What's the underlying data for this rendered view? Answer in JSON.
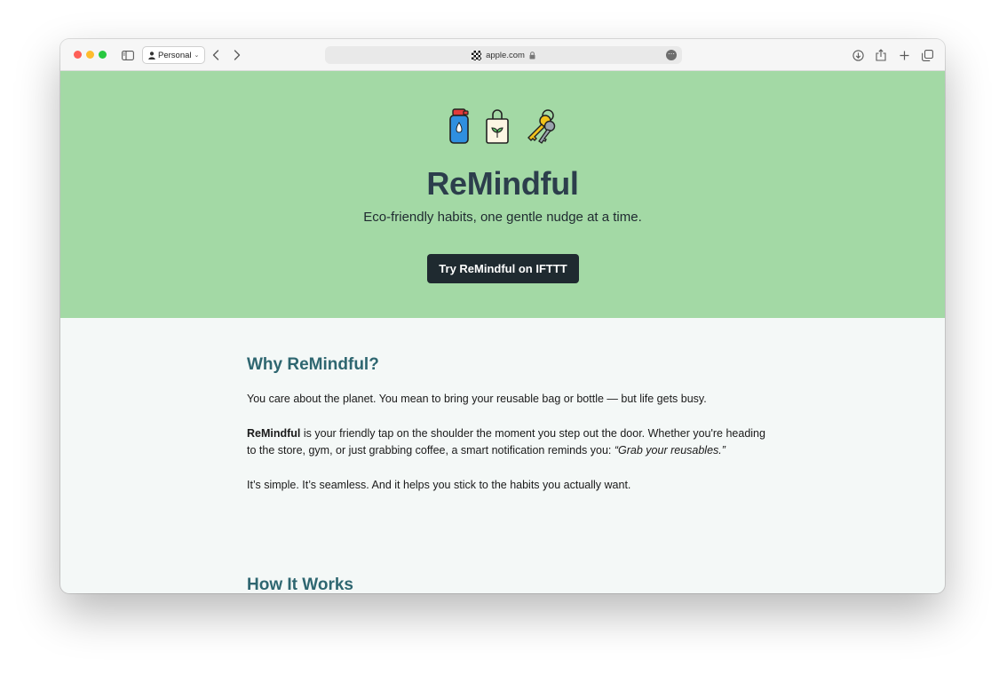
{
  "browser": {
    "profile_label": "Personal",
    "url": "apple.com"
  },
  "hero": {
    "icons": [
      "water-bottle-icon",
      "reusable-bag-icon",
      "keys-icon"
    ],
    "title": "ReMindful",
    "subtitle": "Eco-friendly habits, one gentle nudge at a time.",
    "cta_label": "Try ReMindful on IFTTT",
    "bg_color": "#a3d9a5",
    "cta_color": "#1f2a30"
  },
  "why": {
    "heading": "Why ReMindful?",
    "p1": "You care about the planet. You mean to bring your reusable bag or bottle — but life gets busy.",
    "p2_strong": "ReMindful",
    "p2_text": " is your friendly tap on the shoulder the moment you step out the door. Whether you're heading to the store, gym, or just grabbing coffee, a smart notification reminds you: ",
    "p2_quote": "“Grab your reusables.”",
    "p3": "It’s simple. It’s seamless. And it helps you stick to the habits you actually want."
  },
  "how": {
    "heading": "How It Works"
  },
  "colors": {
    "heading_color": "#2e6670",
    "page_bg": "#f4f8f7"
  }
}
